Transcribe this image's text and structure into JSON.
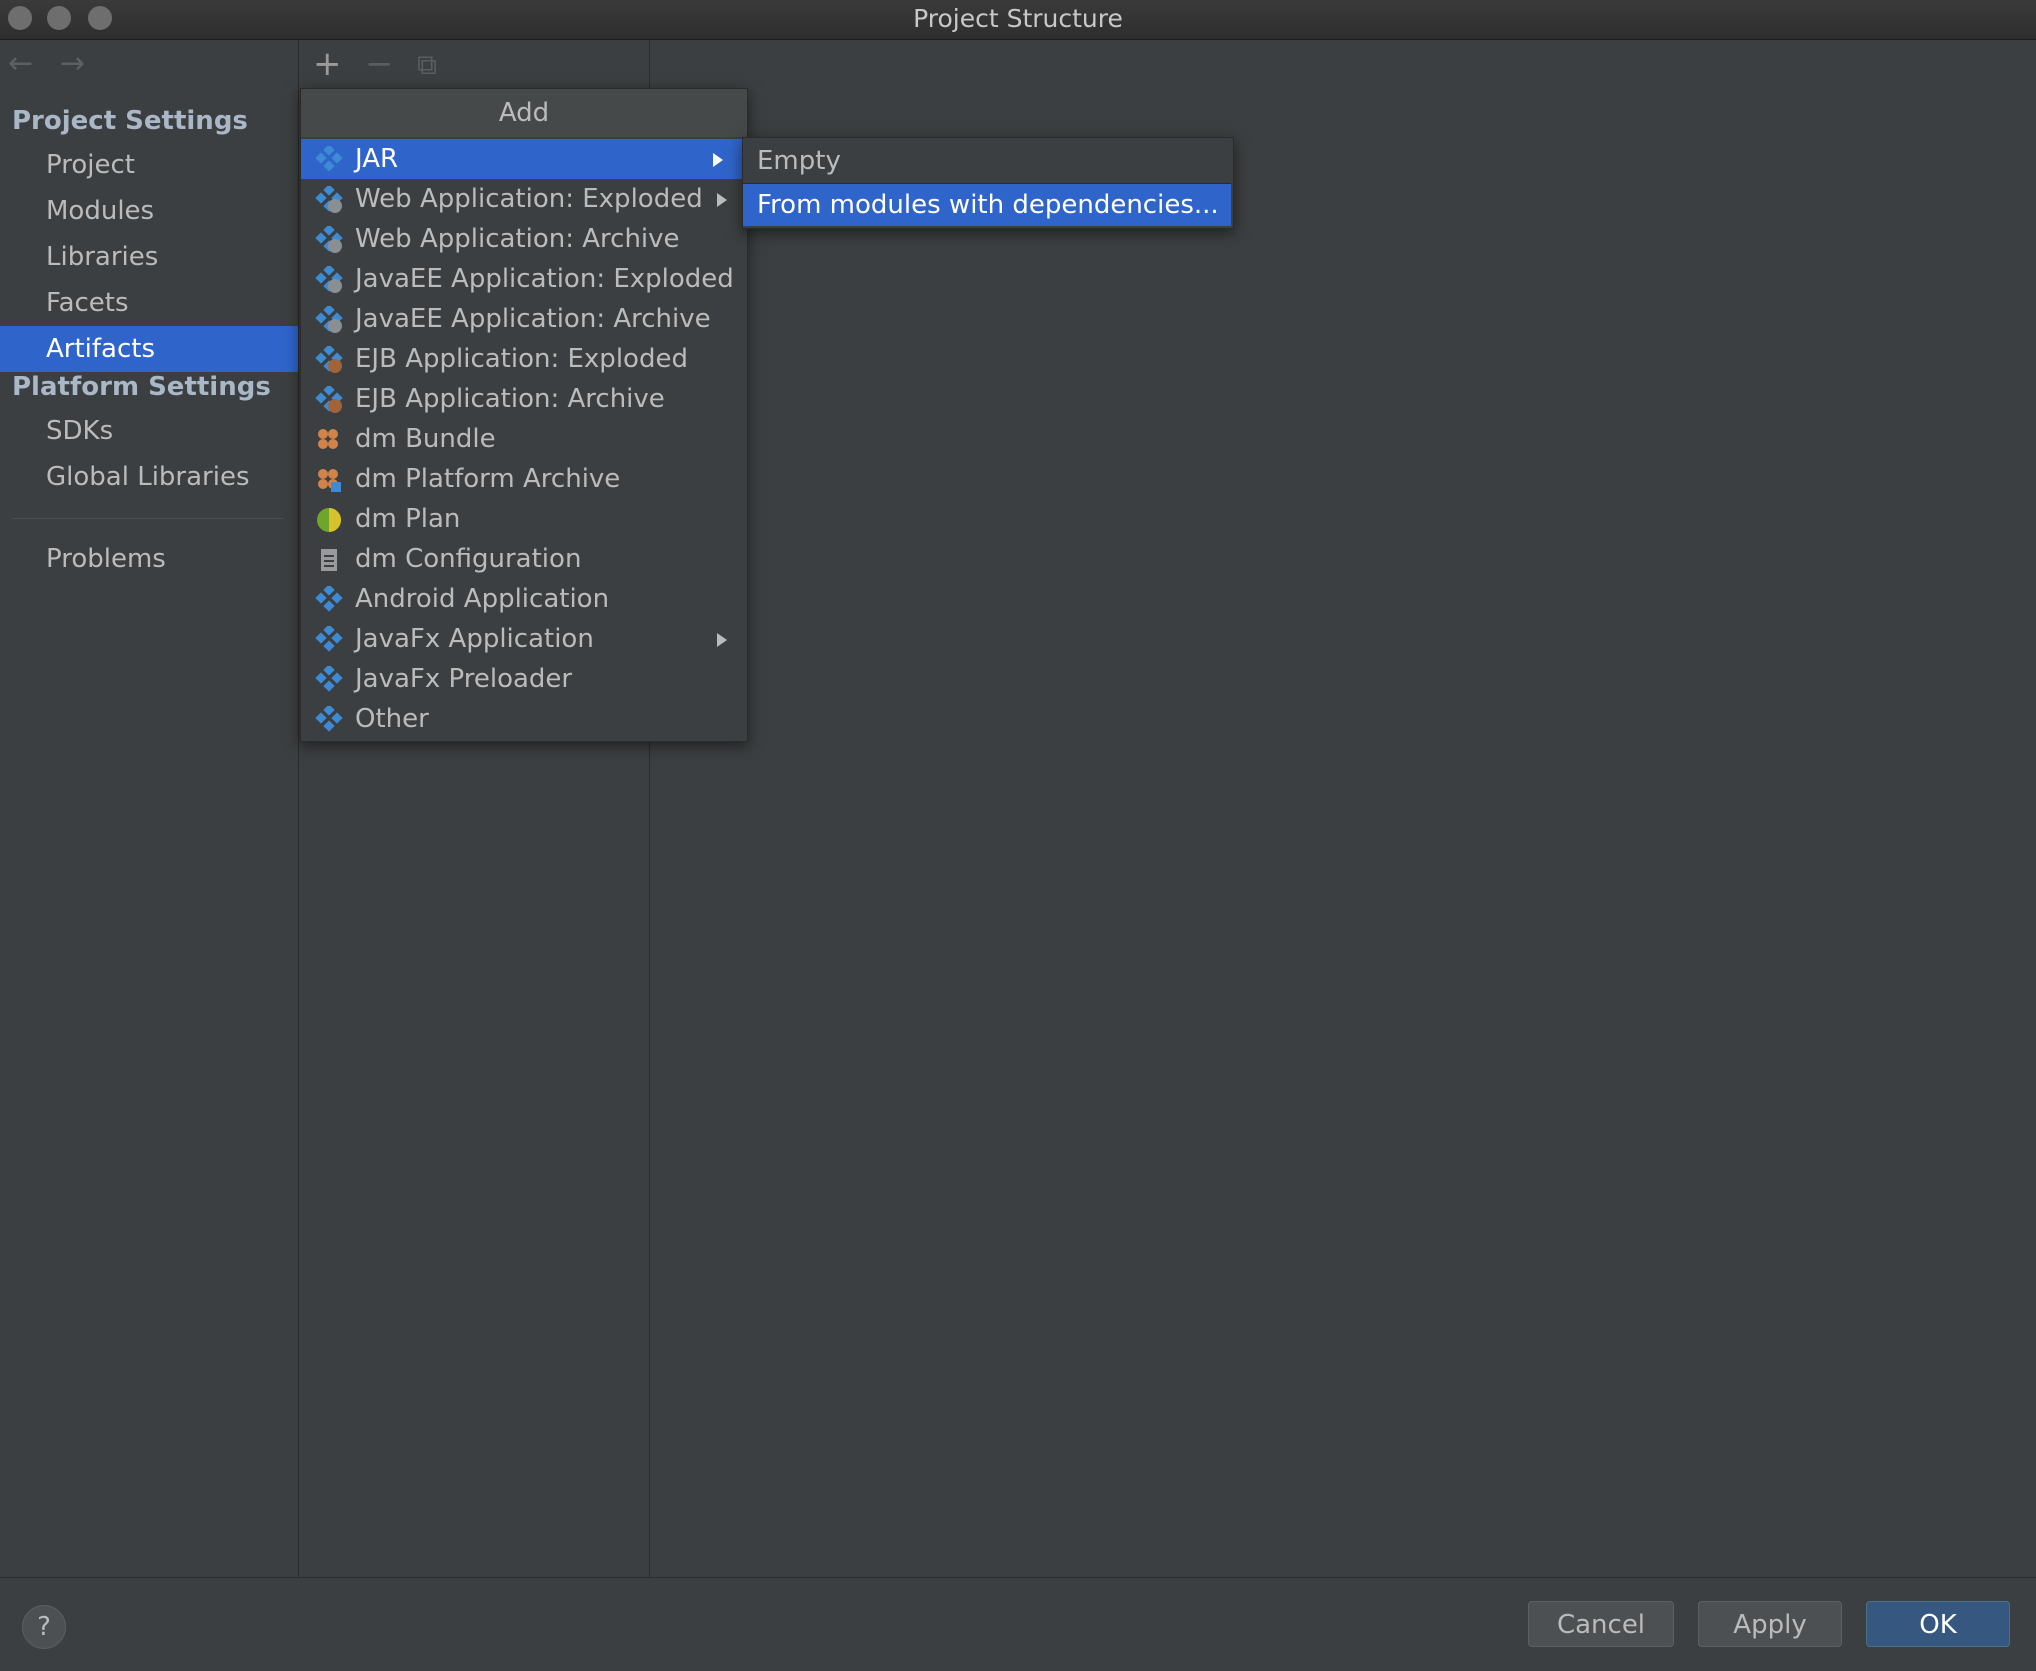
{
  "window": {
    "title": "Project Structure"
  },
  "nav": {
    "back_icon": "←",
    "forward_icon": "→"
  },
  "sidebar": {
    "project_settings_header": "Project Settings",
    "project_items": [
      "Project",
      "Modules",
      "Libraries",
      "Facets",
      "Artifacts"
    ],
    "selected_item": "Artifacts",
    "platform_settings_header": "Platform Settings",
    "platform_items": [
      "SDKs",
      "Global Libraries"
    ],
    "problems_label": "Problems"
  },
  "toolbar": {
    "add_icon": "+",
    "remove_icon": "−",
    "copy_icon": "⧉"
  },
  "add_menu": {
    "header": "Add",
    "items": [
      {
        "label": "JAR",
        "icon": "jar-icon",
        "submenu": true,
        "highlighted": true
      },
      {
        "label": "Web Application: Exploded",
        "icon": "web-app-icon",
        "submenu": true
      },
      {
        "label": "Web Application: Archive",
        "icon": "web-app-icon",
        "submenu": false
      },
      {
        "label": "JavaEE Application: Exploded",
        "icon": "javaee-app-icon",
        "submenu": false
      },
      {
        "label": "JavaEE Application: Archive",
        "icon": "javaee-app-icon",
        "submenu": false
      },
      {
        "label": "EJB Application: Exploded",
        "icon": "ejb-app-icon",
        "submenu": false
      },
      {
        "label": "EJB Application: Archive",
        "icon": "ejb-app-icon",
        "submenu": false
      },
      {
        "label": "dm Bundle",
        "icon": "dm-bundle-icon",
        "submenu": false
      },
      {
        "label": "dm Platform Archive",
        "icon": "dm-platform-archive-icon",
        "submenu": false
      },
      {
        "label": "dm Plan",
        "icon": "dm-plan-icon",
        "submenu": false
      },
      {
        "label": "dm Configuration",
        "icon": "dm-configuration-icon",
        "submenu": false
      },
      {
        "label": "Android Application",
        "icon": "android-app-icon",
        "submenu": false
      },
      {
        "label": "JavaFx Application",
        "icon": "javafx-app-icon",
        "submenu": true
      },
      {
        "label": "JavaFx Preloader",
        "icon": "javafx-preloader-icon",
        "submenu": false
      },
      {
        "label": "Other",
        "icon": "other-artifact-icon",
        "submenu": false
      }
    ]
  },
  "jar_submenu": {
    "items": [
      {
        "label": "Empty",
        "highlighted": false
      },
      {
        "label": "From modules with dependencies...",
        "highlighted": true
      }
    ]
  },
  "footer": {
    "help_label": "?",
    "cancel_label": "Cancel",
    "apply_label": "Apply",
    "ok_label": "OK"
  },
  "colors": {
    "background": "#3c3f41",
    "selection": "#2f65ca",
    "primary_button": "#365880",
    "artifact_icon_blue": "#3d8bd4"
  }
}
